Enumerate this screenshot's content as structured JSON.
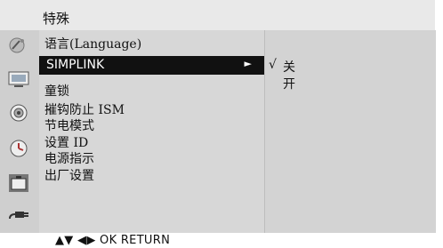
{
  "header": {
    "title": "特殊"
  },
  "menu": {
    "items": [
      {
        "label": "语言(Language)"
      },
      {
        "label": "SIMPLINK",
        "selected": true
      },
      {
        "label": "童锁"
      },
      {
        "label": "摧钩防止 ISM"
      },
      {
        "label": "节电模式"
      },
      {
        "label": "设置 ID"
      },
      {
        "label": "电源指示"
      },
      {
        "label": "出厂设置"
      }
    ],
    "submenu_arrow": "►"
  },
  "submenu": {
    "options": [
      {
        "label": "关",
        "checked": true
      },
      {
        "label": "开",
        "checked": false
      }
    ],
    "check_mark": "√"
  },
  "icons": [
    "satellite-dish-icon",
    "tv-icon",
    "speaker-icon",
    "clock-icon",
    "briefcase-icon",
    "plug-icon"
  ],
  "footer": {
    "nav_hint": "▲▼ ◀▶  OK   RETURN"
  }
}
